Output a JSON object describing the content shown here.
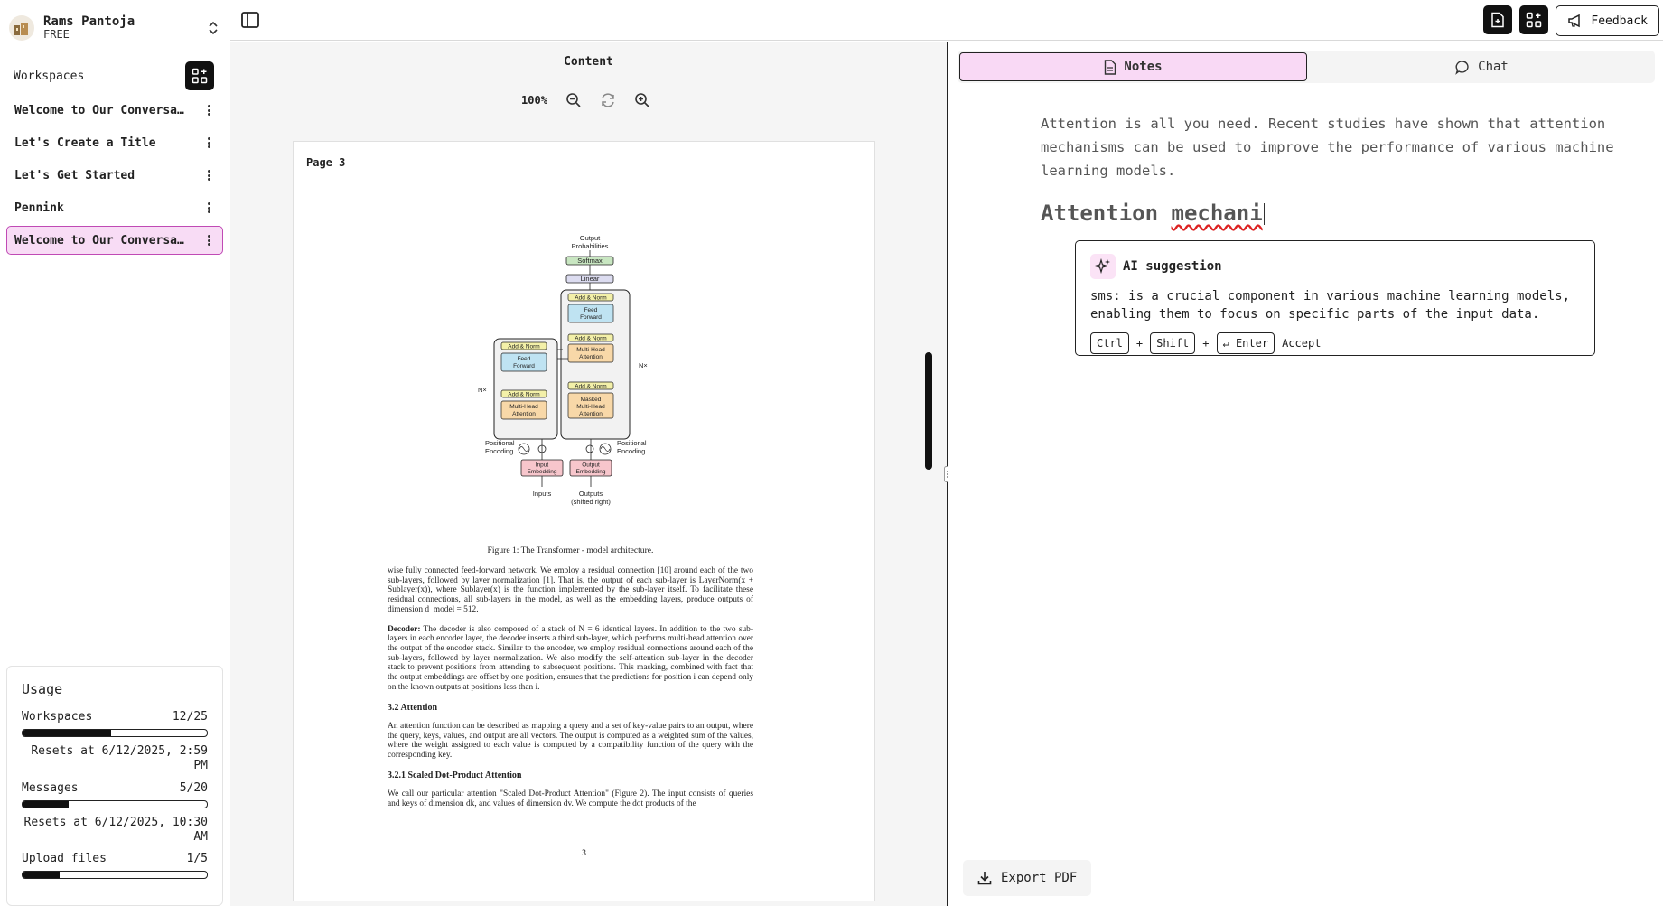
{
  "account": {
    "name": "Rams Pantoja",
    "plan": "FREE"
  },
  "sidebar": {
    "workspaces_label": "Workspaces",
    "items": [
      {
        "label": "Welcome to Our Conversati..."
      },
      {
        "label": "Let's Create a Title"
      },
      {
        "label": "Let's Get Started"
      },
      {
        "label": "Pennink"
      },
      {
        "label": "Welcome to Our Conversati..."
      }
    ],
    "active_index": 4
  },
  "usage": {
    "title": "Usage",
    "workspaces": {
      "label": "Workspaces",
      "value": "12/25",
      "fraction": 0.48,
      "reset": "Resets at 6/12/2025, 2:59 PM"
    },
    "messages": {
      "label": "Messages",
      "value": "5/20",
      "fraction": 0.25,
      "reset": "Resets at 6/12/2025, 10:30 AM"
    },
    "uploads": {
      "label": "Upload files",
      "value": "1/5",
      "fraction": 0.2
    }
  },
  "topbar": {
    "feedback_label": "Feedback"
  },
  "content": {
    "title": "Content",
    "zoom": "100%",
    "page_label": "Page 3",
    "caption": "Figure 1: The Transformer - model architecture.",
    "page_number": "3",
    "paragraphs": {
      "p1": "wise fully connected feed-forward network. We employ a residual connection [10] around each of the two sub-layers, followed by layer normalization [1]. That is, the output of each sub-layer is LayerNorm(x + Sublayer(x)), where Sublayer(x) is the function implemented by the sub-layer itself. To facilitate these residual connections, all sub-layers in the model, as well as the embedding layers, produce outputs of dimension d_model = 512.",
      "decoder_lead": "Decoder:",
      "p2": "The decoder is also composed of a stack of N = 6 identical layers. In addition to the two sub-layers in each encoder layer, the decoder inserts a third sub-layer, which performs multi-head attention over the output of the encoder stack. Similar to the encoder, we employ residual connections around each of the sub-layers, followed by layer normalization. We also modify the self-attention sub-layer in the decoder stack to prevent positions from attending to subsequent positions. This masking, combined with fact that the output embeddings are offset by one position, ensures that the predictions for position i can depend only on the known outputs at positions less than i.",
      "h1": "3.2   Attention",
      "p3": "An attention function can be described as mapping a query and a set of key-value pairs to an output, where the query, keys, values, and output are all vectors. The output is computed as a weighted sum of the values, where the weight assigned to each value is computed by a compatibility function of the query with the corresponding key.",
      "h2": "3.2.1   Scaled Dot-Product Attention",
      "p4": "We call our particular attention \"Scaled Dot-Product Attention\" (Figure 2). The input consists of queries and keys of dimension dk, and values of dimension dv. We compute the dot products of the"
    },
    "diagram": {
      "output_probs": "Output Probabilities",
      "softmax": "Softmax",
      "linear": "Linear",
      "add_norm": "Add & Norm",
      "feed_forward": "Feed Forward",
      "mha": "Multi-Head Attention",
      "masked_mha": "Masked Multi-Head Attention",
      "nx": "N×",
      "pos_enc": "Positional Encoding",
      "input_emb": "Input Embedding",
      "output_emb": "Output Embedding",
      "inputs": "Inputs",
      "outputs": "Outputs (shifted right)"
    }
  },
  "right": {
    "tabs": [
      {
        "label": "Notes"
      },
      {
        "label": "Chat"
      }
    ],
    "note_text": "Attention is all you need. Recent studies have shown that attention mechanisms can be used to improve the performance of various machine learning models.",
    "heading_a": "Attention ",
    "heading_b": "mechani",
    "ai": {
      "title": "AI suggestion",
      "text": "sms: is a crucial component in various machine learning models, enabling them to focus on specific parts of the input data.",
      "keys": [
        "Ctrl",
        "Shift",
        "↵ Enter"
      ],
      "plus": "+",
      "accept": "Accept"
    },
    "export_label": "Export PDF"
  }
}
